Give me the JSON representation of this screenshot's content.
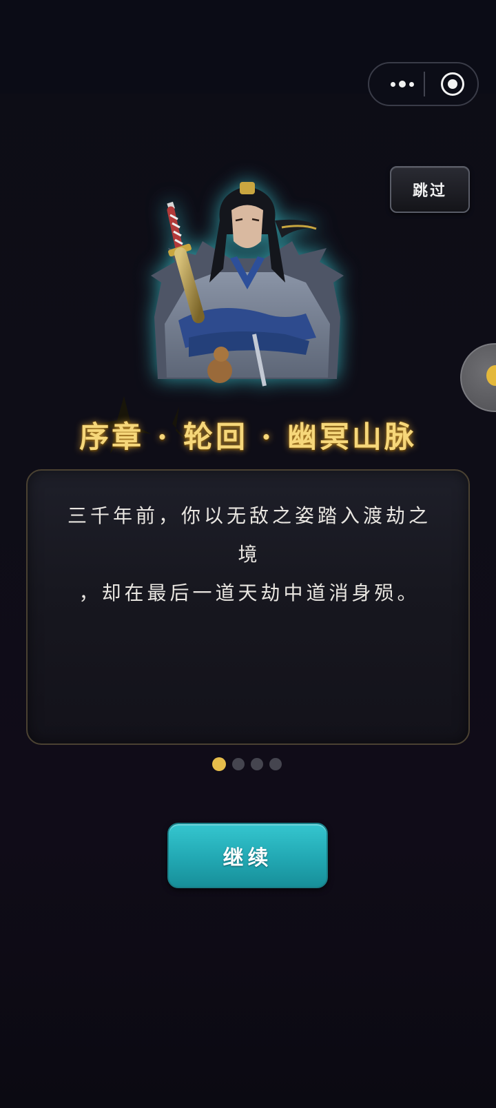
{
  "capsule": {
    "more_icon": "more-dots-icon",
    "close_icon": "target-circle-icon"
  },
  "skip_button": {
    "label": "跳过"
  },
  "floating_button": {
    "icon": "floating-assistant-icon"
  },
  "chapter": {
    "title": "序章 · 轮回 · 幽冥山脉"
  },
  "story": {
    "text_line_1": "三千年前，你以无敌之姿踏入渡劫之境",
    "text_line_2": "，却在最后一道天劫中道消身殒。"
  },
  "pagination": {
    "total": 4,
    "current": 1
  },
  "continue_button": {
    "label": "继续"
  },
  "colors": {
    "accent_gold": "#e6bd4b",
    "title_gold": "#f6d77a",
    "button_teal": "#2ab6c0",
    "background": "#0e0d17"
  }
}
